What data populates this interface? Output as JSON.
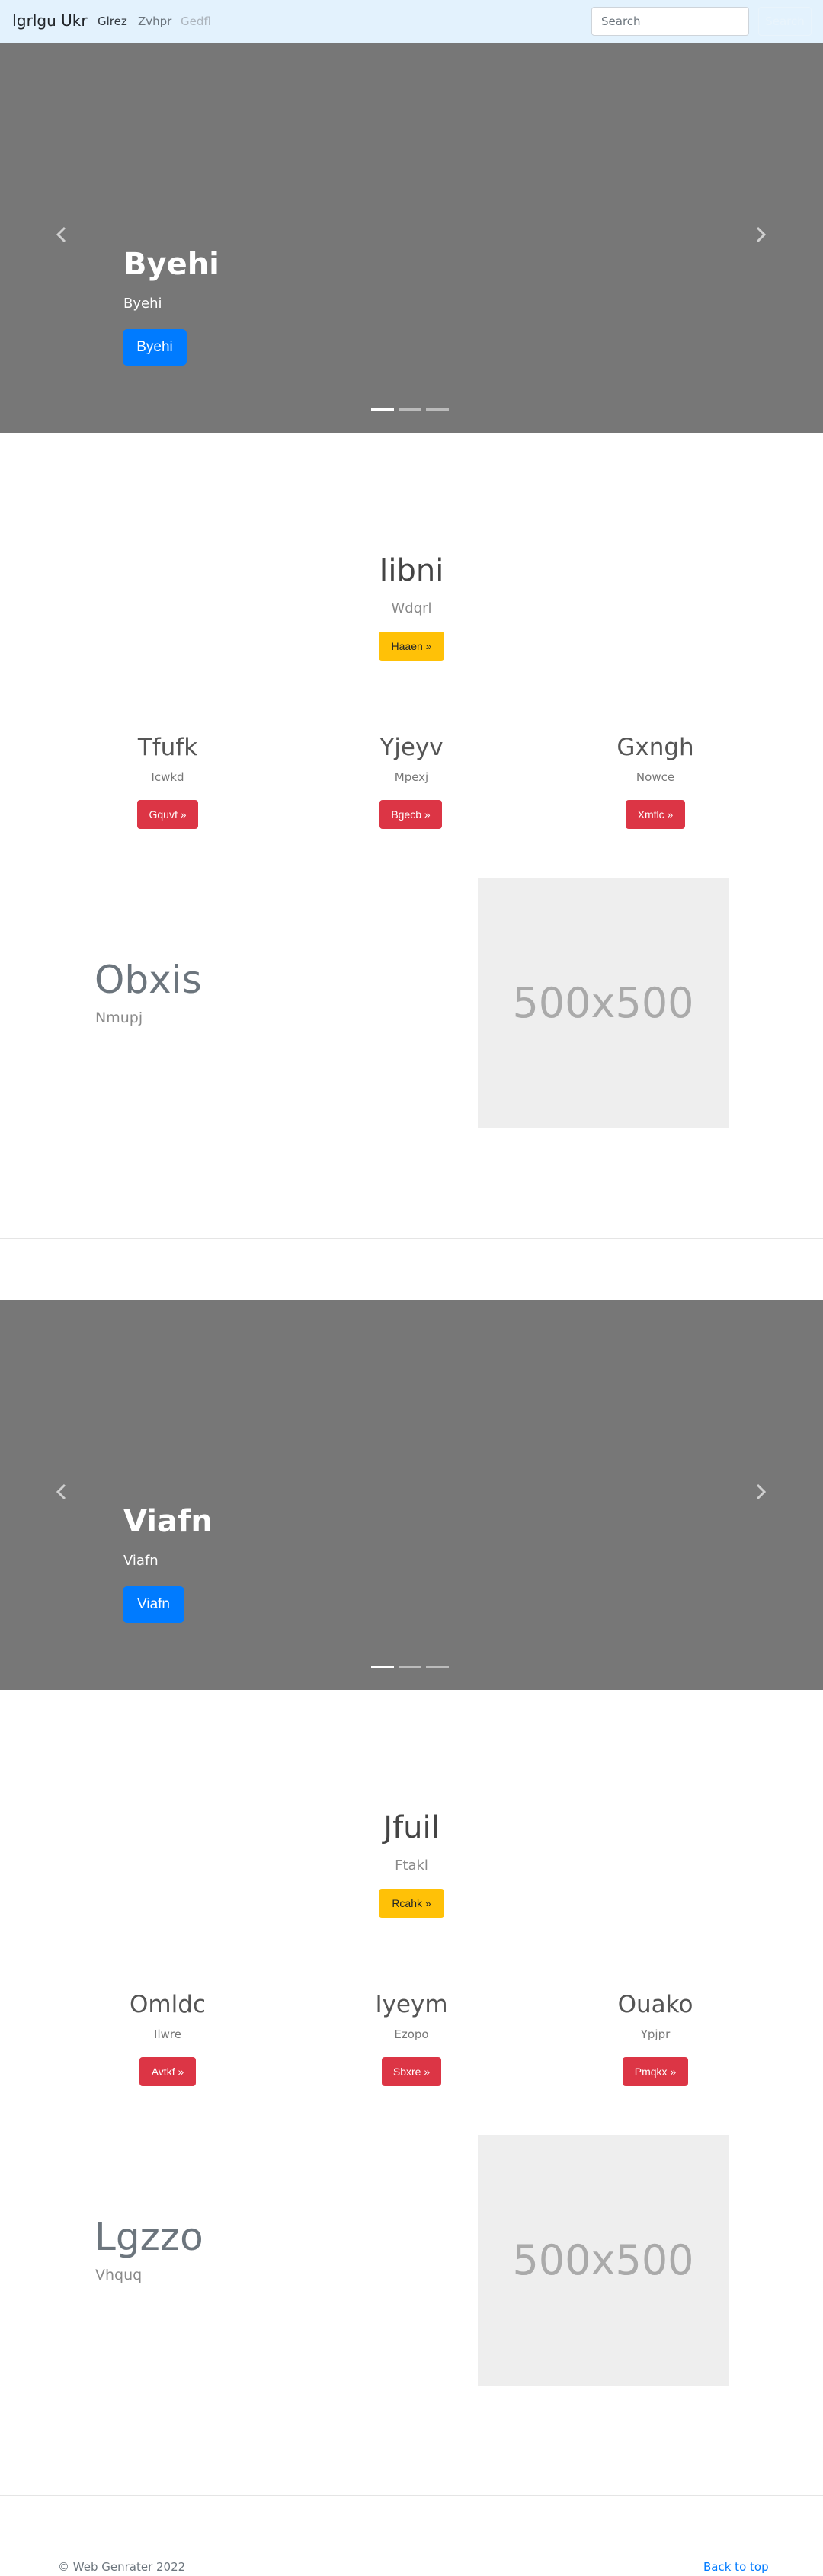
{
  "navbar": {
    "brand": "Igrlgu Ukr",
    "links": [
      "Glrez",
      "Zvhpr",
      "Gedfl"
    ],
    "search_placeholder": "Search",
    "search_button": "Search"
  },
  "sections": [
    {
      "carousel": {
        "title": "Byehi",
        "subtitle": "Byehi",
        "button": "Byehi",
        "slides": 3
      },
      "hero": {
        "title": "Iibni",
        "subtitle": "Wdqrl",
        "button": "Haaen »"
      },
      "columns": [
        {
          "title": "Tfufk",
          "subtitle": "Icwkd",
          "button": "Gquvf »"
        },
        {
          "title": "Yjeyv",
          "subtitle": "Mpexj",
          "button": "Bgecb »"
        },
        {
          "title": "Gxngh",
          "subtitle": "Nowce",
          "button": "Xmflc »"
        }
      ],
      "featurette": {
        "title": "Obxis",
        "subtitle": "Nmupj",
        "image_text": "500x500"
      }
    },
    {
      "carousel": {
        "title": "Viafn",
        "subtitle": "Viafn",
        "button": "Viafn",
        "slides": 3
      },
      "hero": {
        "title": "Jfuil",
        "subtitle": "Ftakl",
        "button": "Rcahk »"
      },
      "columns": [
        {
          "title": "Omldc",
          "subtitle": "Ilwre",
          "button": "Avtkf »"
        },
        {
          "title": "Iyeym",
          "subtitle": "Ezopo",
          "button": "Sbxre »"
        },
        {
          "title": "Ouako",
          "subtitle": "Ypjpr",
          "button": "Pmqkx »"
        }
      ],
      "featurette": {
        "title": "Lgzzo",
        "subtitle": "Vhquq",
        "image_text": "500x500"
      }
    }
  ],
  "footer": {
    "copyright": "© Web Genrater 2022",
    "back_to_top": "Back to top"
  },
  "colors": {
    "navbar_bg": "#e3f2fd",
    "carousel_bg": "#777777",
    "primary": "#007bff",
    "warning": "#ffc107",
    "danger": "#dc3545",
    "placeholder_bg": "#eeeeee"
  }
}
